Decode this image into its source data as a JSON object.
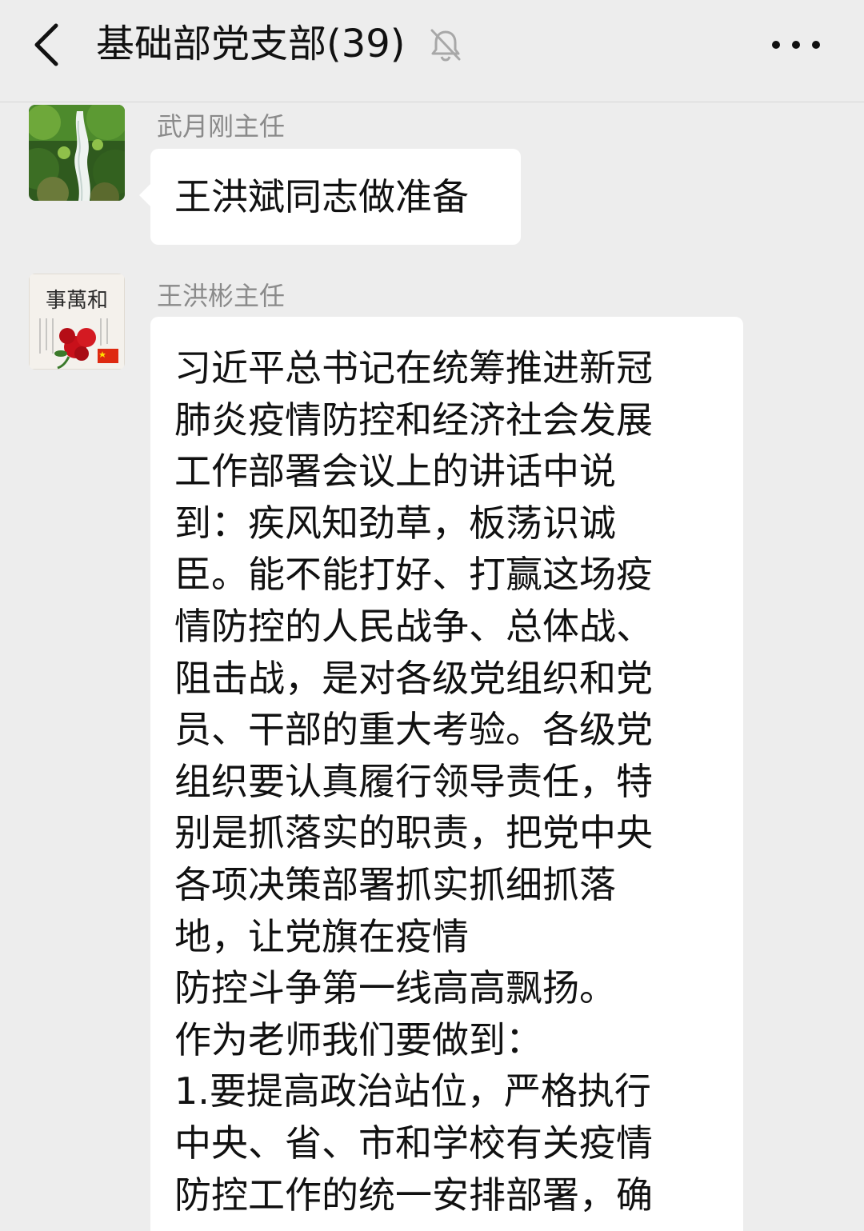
{
  "header": {
    "title": "基础部党支部(39)",
    "back_icon": "chevron-left-icon",
    "mute_icon": "bell-muted-icon",
    "more_icon": "more-dots-icon"
  },
  "messages": [
    {
      "sender": "武月刚主任",
      "avatar": "waterfall-avatar",
      "text": "王洪斌同志做准备"
    },
    {
      "sender": "王洪彬主任",
      "avatar": "flowers-calligraphy-avatar",
      "lines": [
        "习近平总书记在统筹推进新冠",
        "肺炎疫情防控和经济社会发展",
        "工作部署会议上的讲话中说",
        "到：疾风知劲草，板荡识诚",
        "臣。能不能打好、打赢这场疫",
        "情防控的人民战争、总体战、",
        "阻击战，是对各级党组织和党",
        "员、干部的重大考验。各级党",
        "组织要认真履行领导责任，特",
        "别是抓落实的职责，把党中央",
        "各项决策部署抓实抓细抓落",
        "地，让党旗在疫情",
        "防控斗争第一线高高飘扬。",
        "作为老师我们要做到：",
        "1.要提高政治站位，严格执行",
        "中央、省、市和学校有关疫情",
        "防控工作的统一安排部署，确"
      ]
    }
  ],
  "avatar_calligraphy": "事萬和"
}
